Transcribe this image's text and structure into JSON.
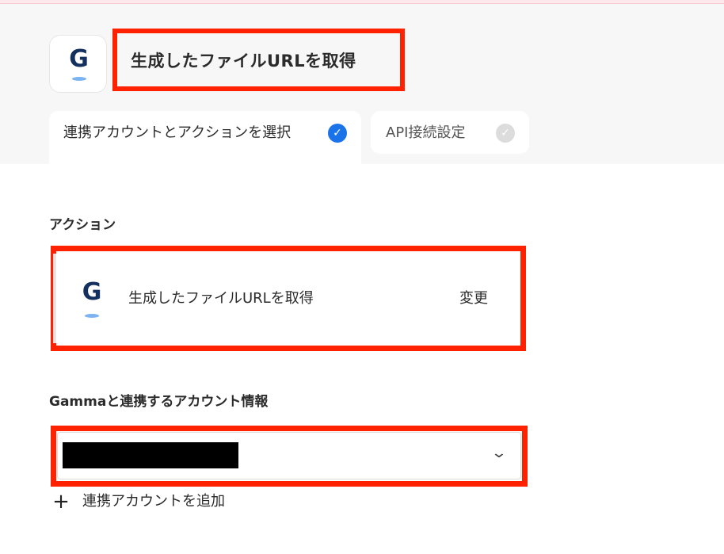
{
  "header": {
    "title": "生成したファイルURLを取得",
    "logo": {
      "icon": "gamma-logo-icon",
      "letter": "G",
      "color": "#14305f",
      "accent": "#7bb4f0"
    }
  },
  "tabs": [
    {
      "label": "連携アカウントとアクションを選択",
      "active": true,
      "status_icon": "check-circle-icon",
      "status_color": "#1a73e8"
    },
    {
      "label": "API接続設定",
      "active": false,
      "status_icon": "check-circle-icon",
      "status_color": "#dcdcdc"
    }
  ],
  "action_section": {
    "label": "アクション",
    "card": {
      "icon": "gamma-logo-icon",
      "letter": "G",
      "title": "生成したファイルURLを取得",
      "change_label": "変更"
    }
  },
  "account_section": {
    "label": "Gammaと連携するアカウント情報",
    "selected_value_redacted": true,
    "dropdown_icon": "chevron-down-icon",
    "add_account_label": "連携アカウントを追加",
    "add_icon": "plus-icon"
  },
  "colors": {
    "highlight": "#ff2200",
    "header_bg": "#f7f7f7"
  }
}
